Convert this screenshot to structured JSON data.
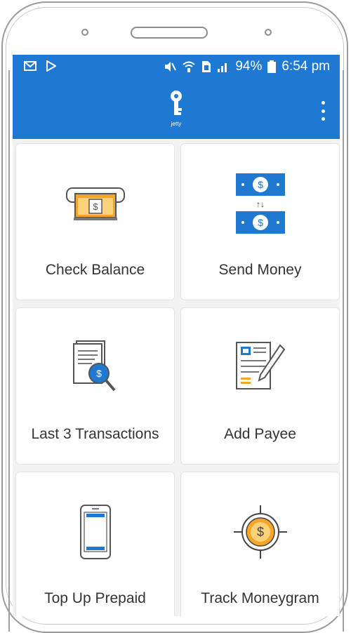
{
  "status_bar": {
    "battery": "94%",
    "time": "6:54 pm",
    "icons": [
      "mail-icon",
      "play-store-icon",
      "mute-icon",
      "wifi-icon",
      "sim-icon",
      "signal-icon",
      "battery-icon"
    ]
  },
  "app_bar": {
    "logo_text": "jetty",
    "menu_icon": "more-vert-icon",
    "color": "#1f78d1"
  },
  "tiles": [
    {
      "label": "Check Balance",
      "icon": "check-balance-icon"
    },
    {
      "label": "Send Money",
      "icon": "send-money-icon"
    },
    {
      "label": "Last 3 Transactions",
      "icon": "transactions-icon"
    },
    {
      "label": "Add Payee",
      "icon": "add-payee-icon"
    },
    {
      "label": "Top Up Prepaid",
      "icon": "phone-topup-icon"
    },
    {
      "label": "Track Moneygram",
      "icon": "track-target-icon"
    }
  ],
  "colors": {
    "accent": "#1f78d1",
    "coin": "#f4a62a",
    "tile_bg": "#ffffff",
    "screen_bg": "#f2f2f2"
  }
}
